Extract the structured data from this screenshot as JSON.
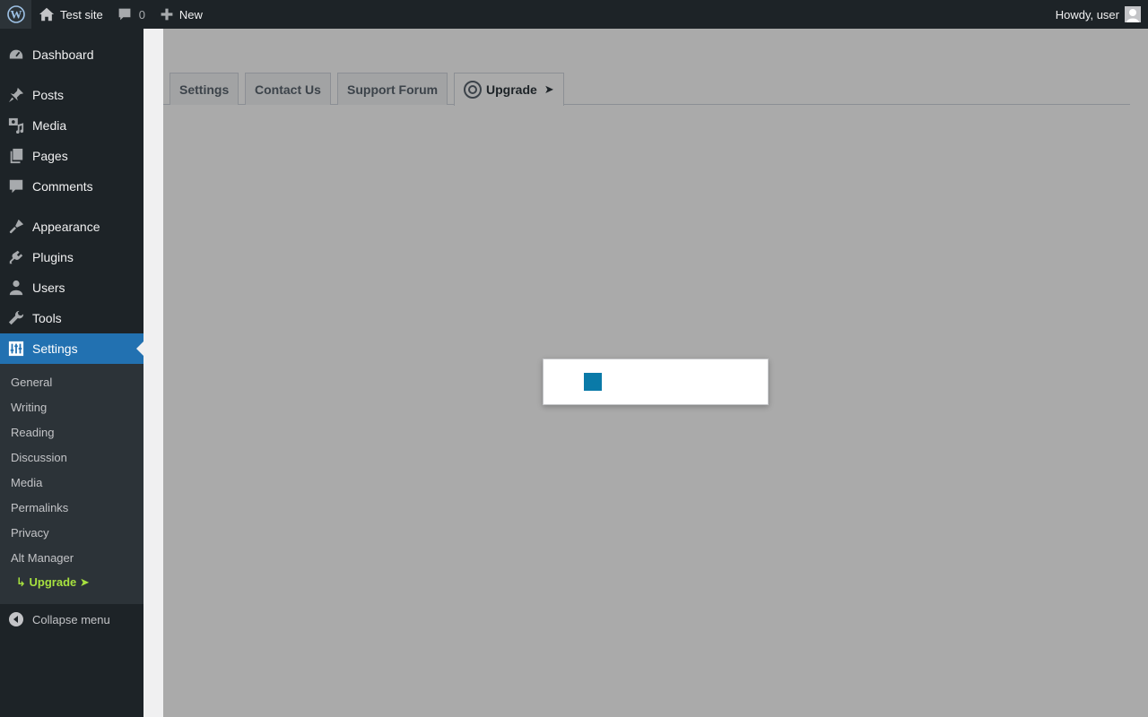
{
  "adminbar": {
    "site_name": "Test site",
    "comments_count": "0",
    "new_label": "New",
    "howdy": "Howdy, user"
  },
  "sidebar": {
    "items": [
      {
        "label": "Dashboard",
        "icon": "dashboard-icon"
      },
      {
        "label": "Posts",
        "icon": "pin-icon"
      },
      {
        "label": "Media",
        "icon": "media-icon"
      },
      {
        "label": "Pages",
        "icon": "pages-icon"
      },
      {
        "label": "Comments",
        "icon": "comment-icon"
      },
      {
        "label": "Appearance",
        "icon": "brush-icon"
      },
      {
        "label": "Plugins",
        "icon": "plugin-icon"
      },
      {
        "label": "Users",
        "icon": "user-icon"
      },
      {
        "label": "Tools",
        "icon": "wrench-icon"
      },
      {
        "label": "Settings",
        "icon": "settings-icon"
      }
    ],
    "submenu": [
      "General",
      "Writing",
      "Reading",
      "Discussion",
      "Media",
      "Permalinks",
      "Privacy",
      "Alt Manager"
    ],
    "upgrade_label": "↳ Upgrade  ➤",
    "collapse_label": "Collapse menu"
  },
  "tabs": {
    "settings": "Settings",
    "contact": "Contact Us",
    "support": "Support Forum",
    "upgrade": "Upgrade",
    "upgrade_arrow": "➤"
  },
  "colors": {
    "accent": "#2271b1",
    "spinner": "#0a7aa8",
    "upgrade_green": "#a7e13f"
  }
}
